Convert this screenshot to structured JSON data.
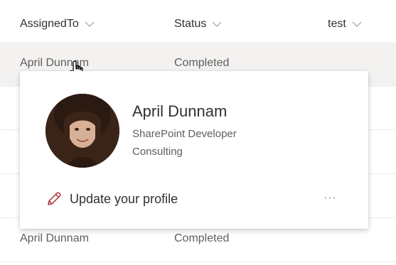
{
  "columns": [
    {
      "label": "AssignedTo"
    },
    {
      "label": "Status"
    },
    {
      "label": "test"
    }
  ],
  "rows": [
    {
      "assigned_to": "April Dunnam",
      "status": "Completed"
    },
    {
      "assigned_to": "April Dunnam",
      "status": "Completed"
    }
  ],
  "card": {
    "name": "April Dunnam",
    "job_title": "SharePoint Developer",
    "department": "Consulting",
    "update_label": "Update your profile",
    "more_label": "···"
  },
  "colors": {
    "accent": "#a4262c",
    "divider": "#edebe9",
    "row_hover": "#f3f2f1"
  },
  "icons": {
    "column_menu": "chevron-down-icon",
    "edit": "pencil-icon",
    "cursor": "hand-cursor-icon"
  }
}
